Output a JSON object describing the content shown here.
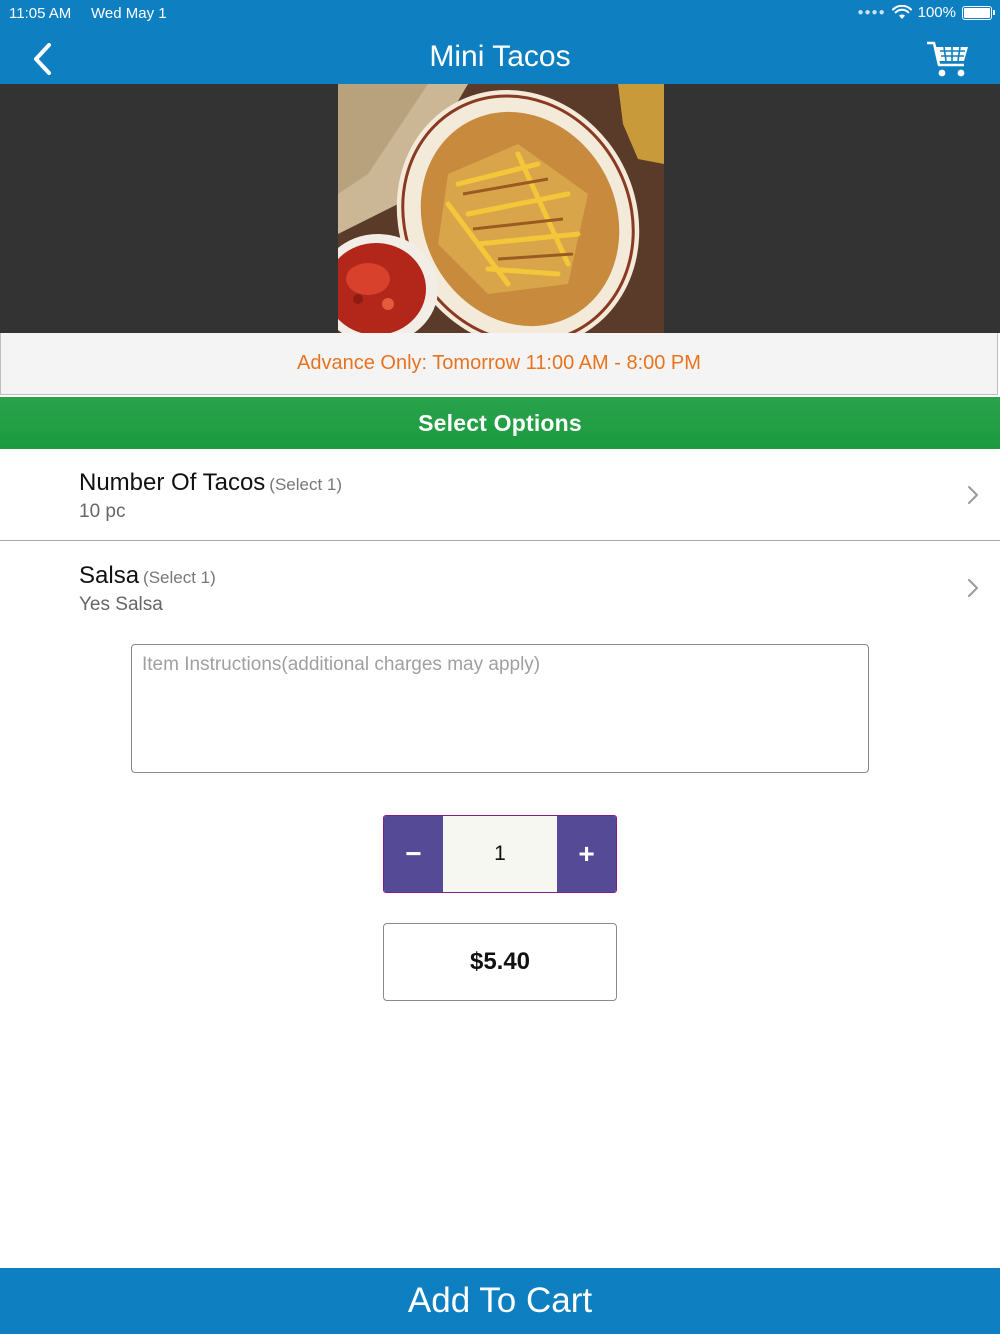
{
  "status_bar": {
    "time": "11:05 AM",
    "date": "Wed May 1",
    "battery": "100%"
  },
  "nav": {
    "title": "Mini Tacos",
    "back_icon": "chevron-left-icon",
    "cart_icon": "shopping-cart-icon"
  },
  "item": {
    "image": "mini-tacos-photo"
  },
  "availability": {
    "text": "Advance Only: Tomorrow 11:00 AM - 8:00 PM"
  },
  "options": {
    "header": "Select Options",
    "items": [
      {
        "name": "Number Of Tacos",
        "hint": "(Select 1)",
        "value": "10 pc"
      },
      {
        "name": "Salsa",
        "hint": "(Select 1)",
        "value": "Yes Salsa"
      }
    ]
  },
  "instructions": {
    "placeholder": "Item Instructions(additional charges may apply)",
    "value": ""
  },
  "quantity": {
    "minus": "−",
    "value": "1",
    "plus": "+"
  },
  "price": {
    "amount": "$5.40"
  },
  "footer": {
    "add_to_cart": "Add To Cart"
  },
  "colors": {
    "primary": "#0e80c2",
    "options_header": "#1f9d43",
    "availability_text": "#e8731f",
    "stepper": "#554a96"
  }
}
